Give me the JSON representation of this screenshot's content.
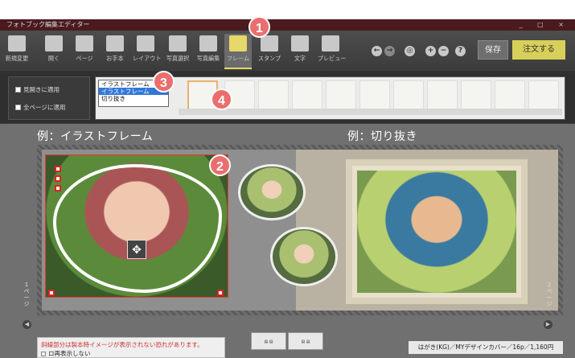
{
  "window": {
    "title": "フォトブック編集エディター",
    "controls": "_ □ ×"
  },
  "toolbar": {
    "tools": [
      {
        "label": "新規変更",
        "icon": "new-icon"
      },
      {
        "label": "開く",
        "icon": "open-icon"
      },
      {
        "label": "ページ",
        "icon": "page-icon"
      },
      {
        "label": "お手本",
        "icon": "thumbs-up-icon"
      },
      {
        "label": "レイアウト",
        "icon": "layout-icon"
      },
      {
        "label": "写真選択",
        "icon": "photo-select-icon"
      },
      {
        "label": "写真編集",
        "icon": "photo-edit-icon"
      },
      {
        "label": "フレーム",
        "icon": "frame-icon"
      },
      {
        "label": "スタンプ",
        "icon": "stamp-icon"
      },
      {
        "label": "文字",
        "icon": "text-icon"
      },
      {
        "label": "プレビュー",
        "icon": "preview-icon"
      }
    ],
    "save_label": "保存",
    "order_label": "注文する",
    "round_buttons": [
      "←",
      "→",
      "◎",
      "+",
      "−",
      "?"
    ]
  },
  "badges": [
    "1",
    "2",
    "3",
    "4"
  ],
  "options": {
    "spread_apply": "見開きに適用",
    "all_pages_apply": "全ページに適用"
  },
  "dropdown": {
    "items": [
      "イラストフレーム",
      "イラストフレーム",
      "切り抜き"
    ],
    "selected_index": 1
  },
  "workspace": {
    "caption_left": "例：イラストフレーム",
    "caption_right": "例：切り抜き",
    "side_left": "1ページ",
    "side_right": "2ページ",
    "warning": "斜線部分は製本時イメージが表示されない恐れがあります。",
    "warning_checkbox": "ロ再表示しない",
    "product_info": "はがき(KG)／MYデザインカバー／16p／1,160円"
  },
  "colors": {
    "accent": "#e6d86a",
    "badge": "#ea6e6e",
    "titlebar": "#4a1a1e"
  }
}
